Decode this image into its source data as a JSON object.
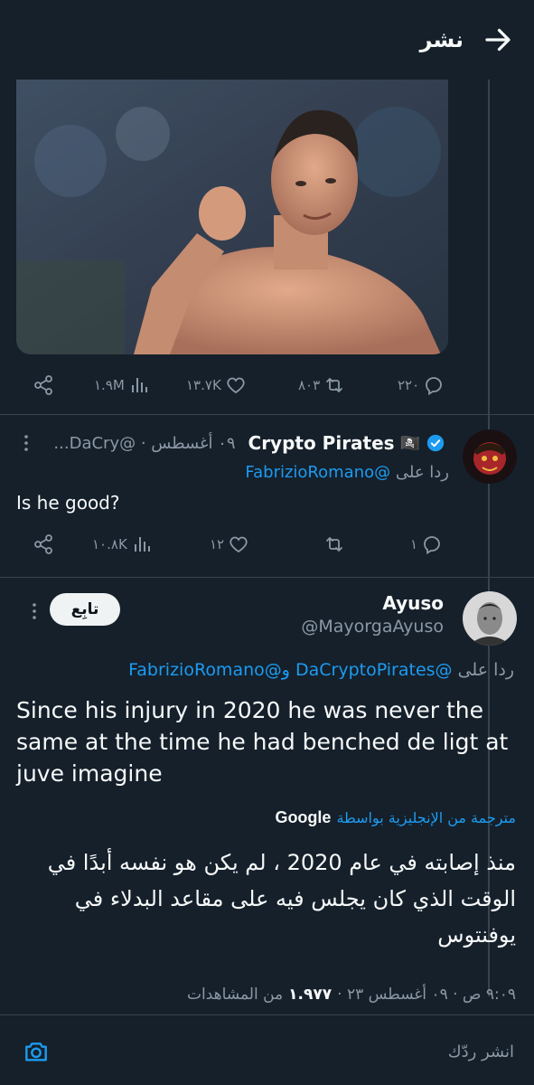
{
  "header": {
    "title": "نشر",
    "back_icon": "arrow-right-icon"
  },
  "top_tweet": {
    "actions": {
      "replies": "٢٢٠",
      "retweets": "٨٠٣",
      "likes": "١٣.٧K",
      "views": "١.٩M"
    }
  },
  "reply1": {
    "name": "Crypto Pirates",
    "emoji": "🏴‍☠️",
    "verified": true,
    "handle_date": "٠٩ أغسطس · @DaCry...",
    "replying_prefix": "ردا على",
    "replying_to": "@FabrizioRomano",
    "text": "Is he good?",
    "actions": {
      "replies": "١",
      "retweets": "",
      "likes": "١٢",
      "views": "١٠.٨K"
    }
  },
  "main_tweet": {
    "name": "Ayuso",
    "handle": "@MayorgaAyuso",
    "follow_label": "تابِع",
    "replying_prefix": "ردا على",
    "replying_to": "@DaCryptoPirates و@FabrizioRomano",
    "text": "Since his injury in 2020 he was never the same at the time he had benched de ligt at juve imagine",
    "translation_label": "مترجمة من الإنجليزية بواسطة",
    "translation_provider": "Google",
    "translated_text": "منذ إصابته في عام 2020 ، لم يكن هو نفسه أبدًا في الوقت الذي كان يجلس فيه على مقاعد البدلاء في يوفنتوس",
    "timestamp": "٩:٠٩ ص · ٠٩ أغسطس ٢٣ ·",
    "views_count": "١.٩٧٧",
    "views_label": "من المشاهدات"
  },
  "composer": {
    "placeholder": "انشر ردّك",
    "camera_icon": "camera-icon"
  },
  "colors": {
    "background": "#15202b",
    "accent": "#1d9bf0",
    "muted": "#8b98a5",
    "border": "#38444d"
  }
}
